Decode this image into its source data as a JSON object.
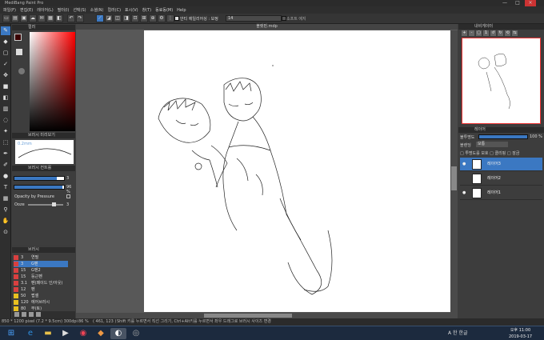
{
  "app": {
    "title": "MediBang Paint Pro",
    "min": "—",
    "max": "□",
    "close": "×"
  },
  "menu": [
    "파일(F)",
    "편집(E)",
    "레이어(L)",
    "필터(I)",
    "선택(S)",
    "소셜(N)",
    "컬러(C)",
    "표시(V)",
    "창(T)",
    "동료동(M)",
    "Help"
  ],
  "toolbar": {
    "antialias_label": "안티 에일리어싱 : 보정",
    "correction_value": "14",
    "soft_edge_label": "소프트 에지"
  },
  "doc_tab": "볼렛핀.mdp",
  "panels": {
    "color": "컬러",
    "brush_preview": "브러시 미리보기",
    "brush_control": "브러시 컨트롤",
    "brush": "브러시",
    "navigator": "내비게이터",
    "layer": "레이어"
  },
  "brush_preview": {
    "size": "0.2mm"
  },
  "brush_control": {
    "size_value": "3",
    "opacity_value": "96 %",
    "size_fill": 0.85,
    "opacity_fill": 0.96,
    "opacity_pressure": "Opacity by Pressure",
    "ooze_label": "Ooze",
    "ooze_value": "3"
  },
  "brush_list": [
    {
      "num": "3",
      "name": "연필",
      "color": "#d84040"
    },
    {
      "num": "3",
      "name": "G펜",
      "color": "#d84040"
    },
    {
      "num": "15",
      "name": "G펜2",
      "color": "#d84040"
    },
    {
      "num": "15",
      "name": "둥근펜",
      "color": "#d84040"
    },
    {
      "num": "3.1",
      "name": "펜(페이드 인/아웃)",
      "color": "#d84040"
    },
    {
      "num": "12",
      "name": "펜",
      "color": "#d84040"
    },
    {
      "num": "50",
      "name": "펍셀",
      "color": "#e8c020"
    },
    {
      "num": "120",
      "name": "에어브러시",
      "color": "#e8c020"
    },
    {
      "num": "80",
      "name": "부(토)",
      "color": "#e8c020"
    }
  ],
  "selected_brush": 1,
  "status": {
    "size": "850 * 1200 pixel  (7.2 * 9.5cm)  300dpi",
    "zoom": "86 %",
    "pos": "( 461, 123 )",
    "hint": "Shift 키를 누르면서 직선 그리기, Ctrl+Alt키를 누르면서 좌우 드래그로 브러시 사이즈 변경"
  },
  "layer_panel": {
    "opacity_label": "불투명도",
    "opacity_value": "100 %",
    "blend_label": "블렌딩",
    "blend_value": "보통",
    "protect": "투명도를 보호",
    "clip": "클리핑",
    "lock": "잠금",
    "layers": [
      {
        "name": "레이어3",
        "visible": true
      },
      {
        "name": "레이어2",
        "visible": false
      },
      {
        "name": "레이어1",
        "visible": true
      }
    ],
    "selected": 0
  },
  "taskbar": {
    "lang": "A 한",
    "date": "2019-03-17",
    "time": "오후 11:00",
    "ime": "한글"
  }
}
